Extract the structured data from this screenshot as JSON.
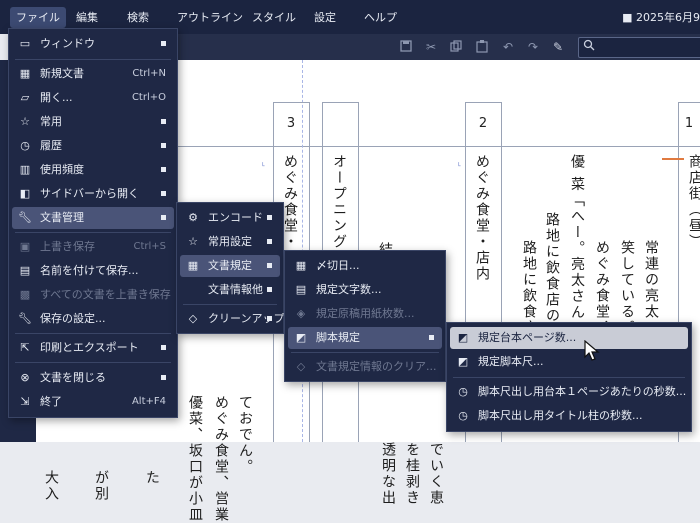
{
  "menubar": {
    "items": [
      "ファイル",
      "編集",
      "検索",
      "アウトライン",
      "スタイル",
      "設定",
      "ヘルプ"
    ],
    "date_text": "■ 2025年6月9"
  },
  "toolbar": {
    "icons": [
      "save-icon",
      "cut-icon",
      "copy-icon",
      "paste-icon",
      "undo-icon",
      "redo-icon",
      "format-icon"
    ],
    "search_icon": "magnifier-icon"
  },
  "document": {
    "page_numbers": [
      "3",
      "2",
      "1"
    ],
    "columns": [
      {
        "text": "めぐみ食堂・"
      },
      {
        "text": "オープニング"
      },
      {
        "text": "結 あ"
      },
      {
        "text": "めぐみ食堂・店内"
      },
      {
        "text": "優 菜「へー。亮太さん"
      },
      {
        "text": "路地に飲食店の連"
      },
      {
        "text": "笑している。"
      },
      {
        "text": "路地に飲食店"
      },
      {
        "text": "めぐみ食堂、"
      },
      {
        "text": "常連の亮太"
      },
      {
        "text": "商店街（昼）"
      },
      {
        "text": "優菜、坂口が小皿"
      },
      {
        "text": "めぐみ食堂、営業"
      },
      {
        "text": "ておでん。"
      },
      {
        "text": "でいく恵"
      },
      {
        "text": "を桂剥き"
      },
      {
        "text": "透明な出"
      },
      {
        "text": "大入"
      },
      {
        "text": "が別"
      },
      {
        "text": "た"
      }
    ]
  },
  "file_menu": {
    "items": [
      {
        "icon": "window-icon",
        "label": "ウィンドウ",
        "shortcut": "",
        "submenu": true,
        "disabled": false
      },
      {
        "icon": "new-document-icon",
        "label": "新規文書",
        "shortcut": "Ctrl+N",
        "submenu": false,
        "disabled": false
      },
      {
        "icon": "folder-icon",
        "label": "開く...",
        "shortcut": "Ctrl+O",
        "submenu": false,
        "disabled": false
      },
      {
        "icon": "star-icon",
        "label": "常用",
        "shortcut": "",
        "submenu": true,
        "disabled": false
      },
      {
        "icon": "history-icon",
        "label": "履歴",
        "shortcut": "",
        "submenu": true,
        "disabled": false
      },
      {
        "icon": "frequency-icon",
        "label": "使用頻度",
        "shortcut": "",
        "submenu": true,
        "disabled": false
      },
      {
        "icon": "sidebar-icon",
        "label": "サイドバーから開く",
        "shortcut": "",
        "submenu": true,
        "disabled": false
      },
      {
        "icon": "wrench-icon",
        "label": "文書管理",
        "shortcut": "",
        "submenu": true,
        "disabled": false
      },
      {
        "icon": "save-icon",
        "label": "上書き保存",
        "shortcut": "Ctrl+S",
        "submenu": false,
        "disabled": true
      },
      {
        "icon": "save-as-icon",
        "label": "名前を付けて保存...",
        "shortcut": "",
        "submenu": false,
        "disabled": false
      },
      {
        "icon": "save-all-icon",
        "label": "すべての文書を上書き保存",
        "shortcut": "",
        "submenu": false,
        "disabled": true
      },
      {
        "icon": "wrench-icon",
        "label": "保存の設定...",
        "shortcut": "",
        "submenu": false,
        "disabled": false
      },
      {
        "icon": "export-icon",
        "label": "印刷とエクスポート",
        "shortcut": "",
        "submenu": true,
        "disabled": false
      },
      {
        "icon": "close-icon",
        "label": "文書を閉じる",
        "shortcut": "",
        "submenu": true,
        "disabled": false
      },
      {
        "icon": "exit-icon",
        "label": "終了",
        "shortcut": "Alt+F4",
        "submenu": false,
        "disabled": false
      }
    ]
  },
  "doc_menu": {
    "items": [
      {
        "icon": "encode-icon",
        "label": "エンコード",
        "submenu": true,
        "disabled": false
      },
      {
        "icon": "star-icon",
        "label": "常用設定",
        "submenu": true,
        "disabled": false
      },
      {
        "icon": "doc-rule-icon",
        "label": "文書規定",
        "submenu": true,
        "disabled": false
      },
      {
        "icon": "",
        "label": "文書情報他",
        "submenu": true,
        "disabled": false
      },
      {
        "icon": "eraser-icon",
        "label": "クリーンアップ",
        "submenu": true,
        "disabled": false
      }
    ]
  },
  "rule_menu": {
    "items": [
      {
        "icon": "calendar-icon",
        "label": "〆切日...",
        "submenu": false,
        "disabled": false
      },
      {
        "icon": "counter-icon",
        "label": "規定文字数...",
        "submenu": false,
        "disabled": false
      },
      {
        "icon": "layers-icon",
        "label": "規定原稿用紙枚数...",
        "submenu": false,
        "disabled": true
      },
      {
        "icon": "clapper-icon",
        "label": "脚本規定",
        "submenu": true,
        "disabled": false
      },
      {
        "icon": "eraser-icon",
        "label": "文書規定情報のクリア...",
        "submenu": false,
        "disabled": true
      }
    ]
  },
  "script_menu": {
    "items": [
      {
        "icon": "clapper-icon",
        "label": "規定台本ページ数..."
      },
      {
        "icon": "clapper-icon",
        "label": "規定脚本尺..."
      },
      {
        "icon": "clock-icon",
        "label": "脚本尺出し用台本１ページあたりの秒数..."
      },
      {
        "icon": "clock-icon",
        "label": "脚本尺出し用タイトル柱の秒数..."
      }
    ]
  },
  "colors": {
    "menu_bg": "#1f2845",
    "menubar_bg": "#1b2440",
    "highlight": "#4a5478",
    "active_highlight": "#c9ccd6",
    "text": "#e8ecf4",
    "disabled": "#6f7891"
  }
}
